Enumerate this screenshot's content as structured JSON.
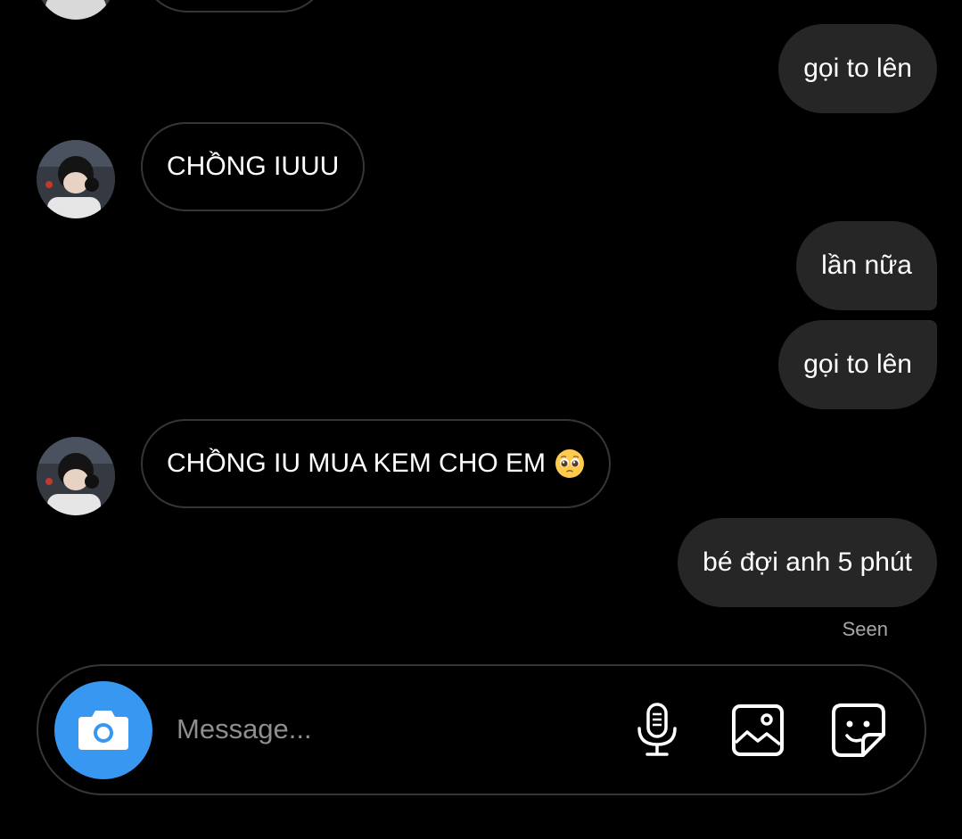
{
  "messages": [
    {
      "id": "m1",
      "direction": "out",
      "text": "gọi to lên"
    },
    {
      "id": "m2",
      "direction": "in",
      "text": "CHỒNG IUUU"
    },
    {
      "id": "m3",
      "direction": "out",
      "text": "lần nữa"
    },
    {
      "id": "m4",
      "direction": "out",
      "text": "gọi to lên"
    },
    {
      "id": "m5",
      "direction": "in",
      "text": "CHỒNG IU MUA KEM CHO EM",
      "emoji": "pleading-face"
    },
    {
      "id": "m6",
      "direction": "out",
      "text": "bé đợi anh 5 phút"
    }
  ],
  "status": {
    "seen": "Seen"
  },
  "composer": {
    "placeholder": "Message...",
    "value": "",
    "icons": [
      "camera-icon",
      "microphone-icon",
      "image-icon",
      "sticker-icon"
    ]
  },
  "colors": {
    "background": "#000000",
    "outgoing_bubble": "#262626",
    "incoming_border": "#363636",
    "camera_button": "#3897f0",
    "secondary_text": "#a8a8a8"
  }
}
